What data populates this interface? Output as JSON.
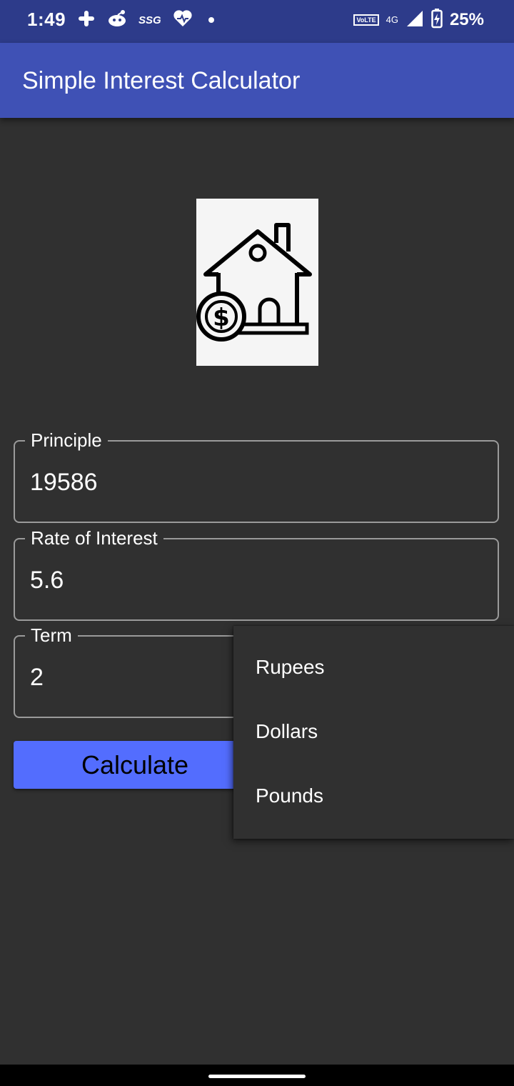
{
  "status_bar": {
    "time": "1:49",
    "left_icons": [
      "slack-icon",
      "reddit-icon",
      "ssg-icon",
      "heart-icon",
      "dot-icon"
    ],
    "ssg_label": "SSG",
    "volte_label": "VoLTE",
    "network_label": "4G",
    "battery_percent": "25%"
  },
  "app_bar": {
    "title": "Simple Interest Calculator",
    "color": "#3f51b5"
  },
  "illustration": {
    "icon": "house-dollar-icon"
  },
  "form": {
    "principle": {
      "label": "Principle",
      "value": "19586"
    },
    "rate": {
      "label": "Rate of Interest",
      "value": "5.6"
    },
    "term": {
      "label": "Term",
      "value": "2"
    }
  },
  "calculate_button": {
    "label": "Calculate",
    "color": "#536dfe"
  },
  "currency_menu": {
    "options": [
      "Rupees",
      "Dollars",
      "Pounds"
    ]
  },
  "colors": {
    "background": "#303030",
    "status_bar": "#2d3b8a"
  }
}
